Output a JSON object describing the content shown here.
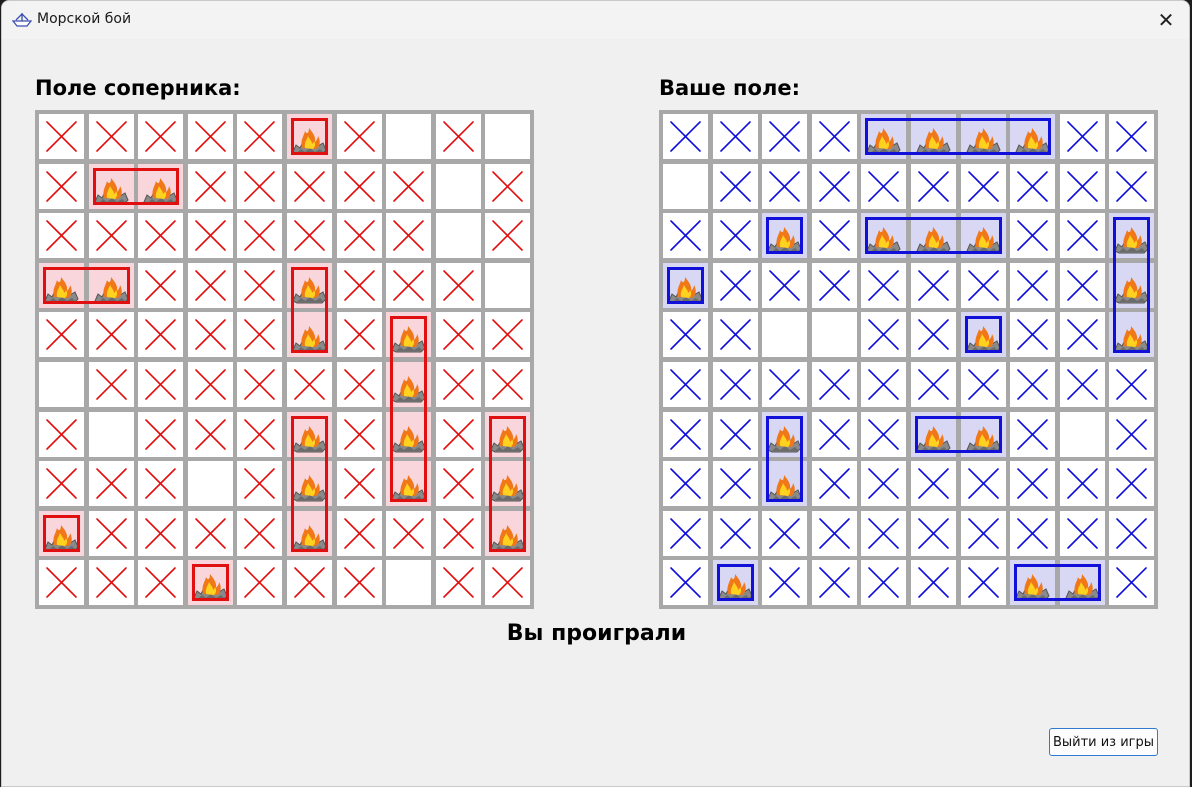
{
  "window": {
    "title": "Морской бой",
    "close_glyph": "✕",
    "app_icon": "paper-boat-icon"
  },
  "opponent_board": {
    "heading": "Поле соперника:",
    "color": "#e01010",
    "cells": [
      "XXXXXHX.X.",
      "XHHXXXXX.X",
      "XXXXXXXX.X",
      "HHXXXHXXX.",
      "XXXXXHXHXX",
      ".XXXXXXHXX",
      "X.XXXHXHXH",
      "XXX.XHXHXH",
      "HXXXXHXXXH",
      "XXXHXXX.XX"
    ],
    "ships": [
      {
        "row": 0,
        "col": 5,
        "len": 1,
        "dir": "h"
      },
      {
        "row": 1,
        "col": 1,
        "len": 2,
        "dir": "h"
      },
      {
        "row": 3,
        "col": 0,
        "len": 2,
        "dir": "h"
      },
      {
        "row": 3,
        "col": 5,
        "len": 2,
        "dir": "v"
      },
      {
        "row": 4,
        "col": 7,
        "len": 4,
        "dir": "v"
      },
      {
        "row": 6,
        "col": 5,
        "len": 3,
        "dir": "v"
      },
      {
        "row": 6,
        "col": 9,
        "len": 3,
        "dir": "v"
      },
      {
        "row": 8,
        "col": 0,
        "len": 1,
        "dir": "h"
      },
      {
        "row": 9,
        "col": 3,
        "len": 1,
        "dir": "h"
      }
    ]
  },
  "player_board": {
    "heading": "Ваше поле:",
    "color": "#1010d8",
    "cells": [
      "XXXXHHHHXX",
      ".XXXXXXXXX",
      "XXHXHHHXXH",
      "HXXXXXXXXH",
      "XX..XXHXXH",
      "XXXXXXXXXX",
      "XXHXXHHX.X",
      "XXHXXXXXXX",
      "XXXXXXXXXX",
      "XHXXXXXHHX"
    ],
    "ships": [
      {
        "row": 0,
        "col": 4,
        "len": 4,
        "dir": "h"
      },
      {
        "row": 2,
        "col": 2,
        "len": 1,
        "dir": "h"
      },
      {
        "row": 2,
        "col": 4,
        "len": 3,
        "dir": "h"
      },
      {
        "row": 2,
        "col": 9,
        "len": 3,
        "dir": "v"
      },
      {
        "row": 3,
        "col": 0,
        "len": 1,
        "dir": "h"
      },
      {
        "row": 4,
        "col": 6,
        "len": 1,
        "dir": "h"
      },
      {
        "row": 6,
        "col": 2,
        "len": 2,
        "dir": "v"
      },
      {
        "row": 6,
        "col": 5,
        "len": 2,
        "dir": "h"
      },
      {
        "row": 9,
        "col": 1,
        "len": 1,
        "dir": "h"
      },
      {
        "row": 9,
        "col": 7,
        "len": 2,
        "dir": "h"
      }
    ]
  },
  "legend": {
    "X": "miss-mark",
    "H": "hit-fire-icon",
    ".": "empty"
  },
  "result_text": "Вы проиграли",
  "exit_button_label": "Выйти из игры"
}
